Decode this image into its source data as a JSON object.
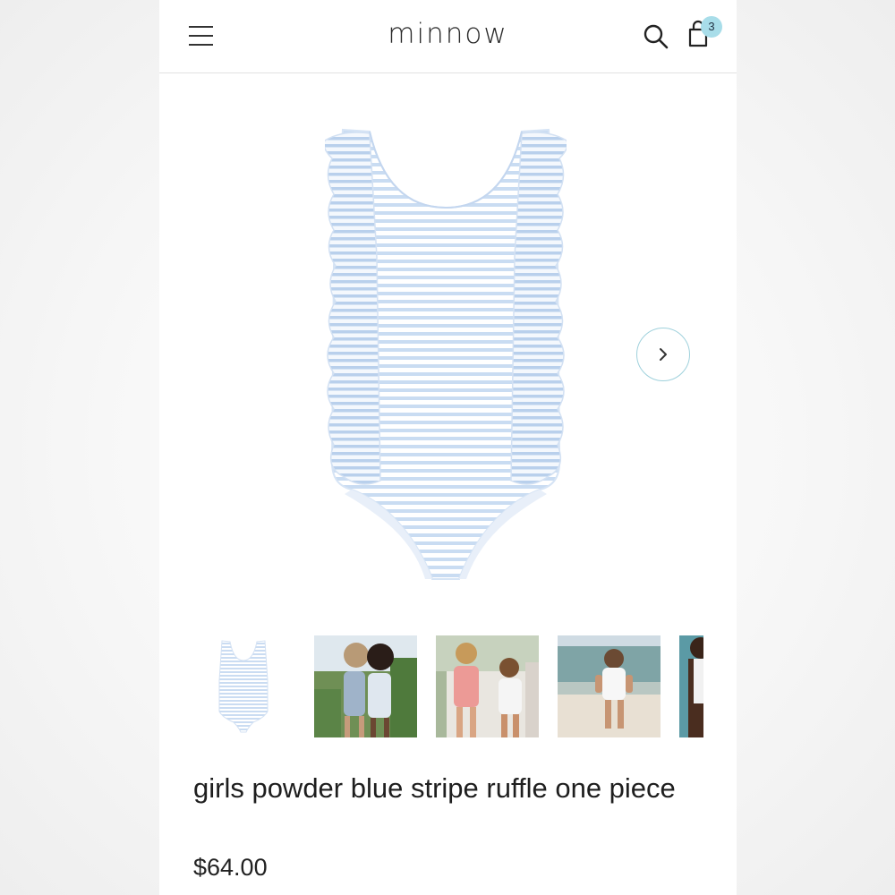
{
  "header": {
    "brand": "minnow",
    "cart_count": "3"
  },
  "icons": {
    "menu": "hamburger-menu-icon",
    "search": "search-icon",
    "cart": "shopping-bag-icon",
    "next": "chevron-right-icon"
  },
  "product": {
    "title": "girls powder blue stripe ruffle one piece",
    "price": "$64.00"
  },
  "gallery": {
    "thumbnail_count": 5
  },
  "colors": {
    "accent": "#a8dde9",
    "stripe": "#c9dcf2"
  }
}
